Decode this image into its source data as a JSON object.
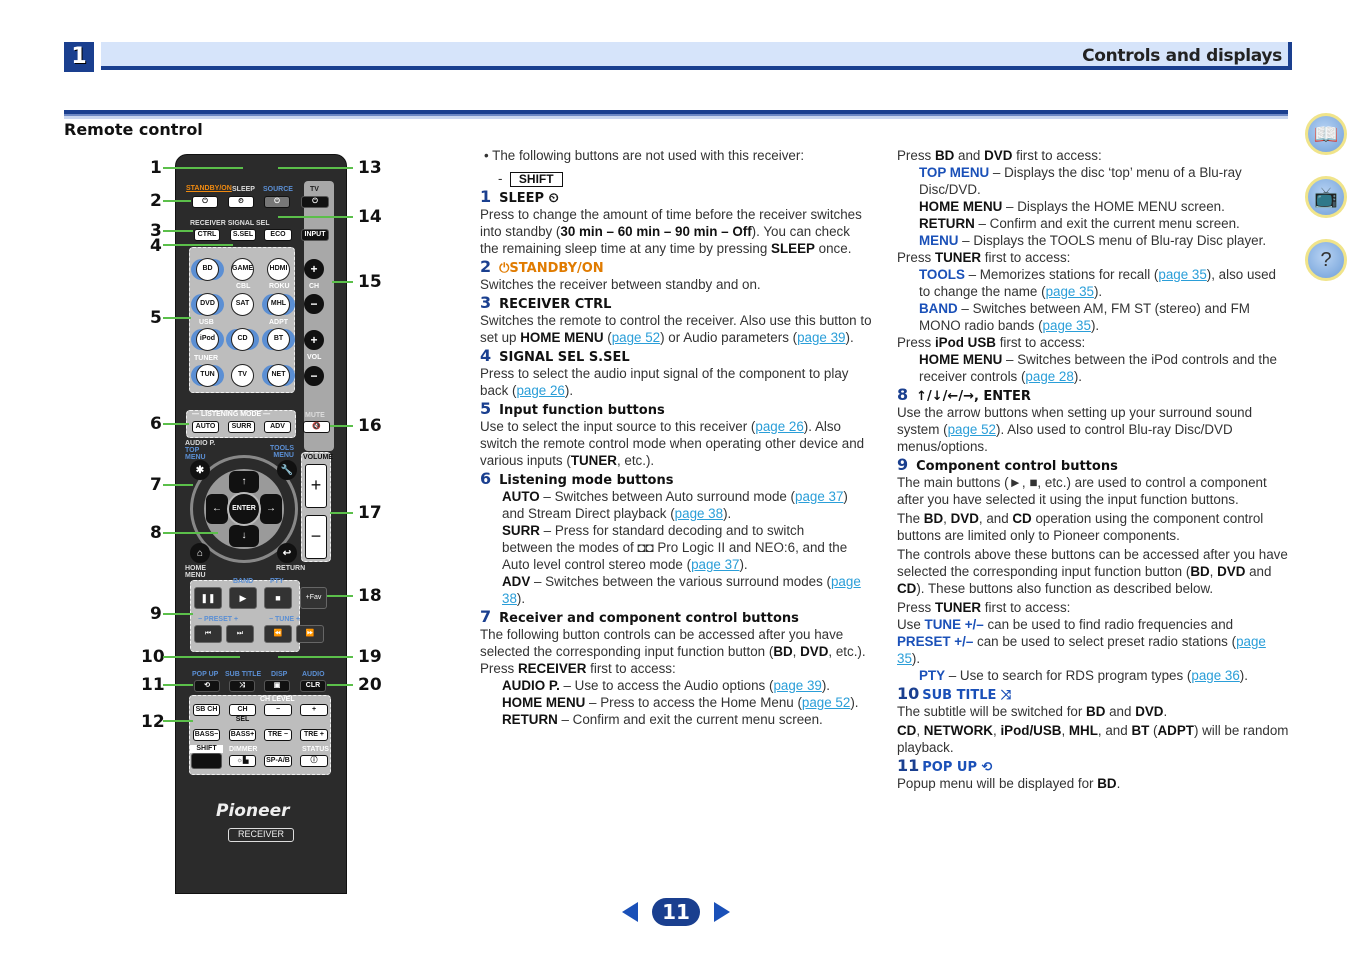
{
  "header": {
    "chapter": "1",
    "title": "Controls and displays"
  },
  "section_title": "Remote control",
  "side_icons": [
    "book-icon",
    "receiver-remote-icon",
    "help-receiver-icon"
  ],
  "remote": {
    "labels": {
      "standby": "STANDBY/ON",
      "sleep": "SLEEP",
      "source": "SOURCE",
      "tv": "TV",
      "receiver_signal_sel": "RECEIVER SIGNAL SEL",
      "ctrl": "CTRL",
      "ssel": "S.SEL",
      "eco": "ECO",
      "input": "INPUT",
      "bd": "BD",
      "game": "GAME",
      "hdmi": "HDMI",
      "cbl": "CBL",
      "roku": "ROKU",
      "dvd": "DVD",
      "sat": "SAT",
      "mhl": "MHL",
      "usb": "USB",
      "adpt": "ADPT",
      "ipod": "iPod",
      "cd": "CD",
      "bt": "BT",
      "tuner": "TUNER",
      "tun": "TUN",
      "tvbtn": "TV",
      "net": "NET",
      "ch": "CH",
      "vol": "VOL",
      "plus": "+",
      "minus": "−",
      "listening_mode": "— LISTENING MODE —",
      "mute": "MUTE",
      "auto": "AUTO",
      "surr": "SURR",
      "adv": "ADV",
      "audio_p": "AUDIO P.",
      "top_menu": "TOP\nMENU",
      "tools": "TOOLS\nMENU",
      "volume": "VOLUME",
      "enter": "ENTER",
      "home_menu": "HOME\nMENU",
      "return": "RETURN",
      "band": "BAND",
      "pty": "PTY",
      "fav": "+Fav",
      "preset": "− PRESET +",
      "tune": "− TUNE +",
      "pop_up": "POP UP",
      "sub_title": "SUB TITLE",
      "disp": "DISP",
      "audio": "AUDIO",
      "clr": "CLR",
      "ch_level": "CH LEVEL",
      "sb_ch": "SB CH",
      "ch_sel": "CH SEL",
      "bass_minus": "BASS−",
      "bass_plus": "BASS+",
      "tre_minus": "TRE −",
      "tre_plus": "TRE +",
      "shift": "SHIFT",
      "dimmer": "DIMMER",
      "sp_ab": "SP-A/B",
      "status": "STATUS",
      "brand": "Pioneer",
      "receiver": "RECEIVER"
    },
    "callouts_left": [
      "1",
      "2",
      "3",
      "4",
      "5",
      "6",
      "7",
      "8",
      "9",
      "10",
      "11",
      "12"
    ],
    "callouts_right": [
      "13",
      "14",
      "15",
      "16",
      "17",
      "18",
      "19",
      "20"
    ]
  },
  "col1": {
    "bullet": "The following buttons are not used with this receiver:",
    "dash": "-",
    "shift": "SHIFT",
    "items": [
      {
        "num": "1",
        "title": "SLEEP ⏲",
        "body": [
          "Press to change the amount of time before the receiver switches into standby (",
          "30 min – 60 min – 90 min – Off",
          "). You can check the remaining sleep time at any time by pressing ",
          "SLEEP",
          " once."
        ]
      },
      {
        "num": "2",
        "title": "⏻STANDBY/ON",
        "body": [
          "Switches the receiver between standby and on."
        ]
      },
      {
        "num": "3",
        "title": "RECEIVER CTRL",
        "body": [
          "Switches the remote to control the receiver. Also use this button to set up ",
          "HOME MENU",
          " (",
          "page 52",
          ") or Audio parameters (",
          "page 39",
          ")."
        ]
      },
      {
        "num": "4",
        "title": "SIGNAL SEL S.SEL",
        "body": [
          "Press to select the audio input signal of the component to play back (",
          "page 26",
          ")."
        ]
      },
      {
        "num": "5",
        "title": "Input function buttons",
        "body": [
          "Use to select the input source to this receiver (",
          "page 26",
          "). Also switch the remote control mode when operating other device and various inputs (",
          "TUNER",
          ", etc.)."
        ]
      },
      {
        "num": "6",
        "title": "Listening mode buttons",
        "sub": [
          {
            "key": "AUTO",
            "text": " – Switches between Auto surround mode (",
            "l1": "page 37",
            "t2": ") and Stream Direct playback (",
            "l2": "page 38",
            "t3": ")."
          },
          {
            "key": "SURR",
            "text": " – Press for standard decoding and to switch"
          },
          {
            "text": "between the modes of ◘◘ Pro Logic II and NEO:6, and the Auto level control stereo mode (",
            "l1": "page 37",
            "t2": ")."
          },
          {
            "key": "ADV",
            "text": " – Switches between the various surround modes (",
            "l1": "page 38",
            "t2": ")."
          }
        ]
      },
      {
        "num": "7",
        "title": "Receiver and component control buttons",
        "body": [
          "The following button controls can be accessed after you have selected the corresponding input function button (",
          "BD",
          ", ",
          "DVD",
          ", etc.)."
        ],
        "press": [
          "Press ",
          "RECEIVER",
          " first to access:"
        ],
        "sub": [
          {
            "key": "AUDIO P.",
            "text": " – Use to access the Audio options (",
            "l1": "page 39",
            "t2": ")."
          },
          {
            "key": "HOME MENU",
            "text": " – Press to access the Home Menu (",
            "l1": "page 52",
            "t2": ")."
          },
          {
            "key": "RETURN",
            "text": " – Confirm and exit the current menu screen."
          }
        ]
      }
    ]
  },
  "col2": {
    "press_bd": [
      "Press ",
      "BD",
      " and ",
      "DVD",
      " first to access:"
    ],
    "bd_items": [
      {
        "key": "TOP MENU",
        "blue": true,
        "text": " – Displays the disc ‘top’ menu of a Blu-ray Disc/DVD."
      },
      {
        "key": "HOME MENU",
        "text": " – Displays the HOME MENU screen."
      },
      {
        "key": "RETURN",
        "text": " – Confirm and exit the current menu screen."
      },
      {
        "key": "MENU",
        "blue": true,
        "text": " – Displays the TOOLS menu of Blu-ray Disc player."
      }
    ],
    "press_tuner": [
      "Press ",
      "TUNER",
      " first to access:"
    ],
    "tuner_items": [
      {
        "key": "TOOLS",
        "text": " – Memorizes stations for recall (",
        "l1": "page 35",
        "t2": "), also used to change the name (",
        "l2": "page 35",
        "t3": ")."
      },
      {
        "key": "BAND",
        "text": " – Switches between AM, FM ST (stereo) and FM MONO radio bands (",
        "l1": "page 35",
        "t2": ")."
      }
    ],
    "press_ipod": [
      "Press ",
      "iPod USB",
      " first to access:"
    ],
    "ipod_items": [
      {
        "key": "HOME MENU",
        "text": " – Switches between the iPod controls and the receiver controls (",
        "l1": "page 28",
        "t2": ")."
      }
    ],
    "item8": {
      "num": "8",
      "title": "↑/↓/←/→, ENTER",
      "body": [
        "Use the arrow buttons when setting up your surround sound system (",
        "page 52",
        "). Also used to control Blu-ray Disc/DVD menus/options."
      ]
    },
    "item9": {
      "num": "9",
      "title": "Component control buttons",
      "p1": "The main buttons (►, ■, etc.) are used to control a component after you have selected it using the input function buttons.",
      "p2": [
        "The ",
        "BD",
        ", ",
        "DVD",
        ", and ",
        "CD",
        " operation using the component control buttons are limited only to Pioneer components."
      ],
      "p3": [
        "The controls above these buttons can be accessed after you have selected the corresponding input function button (",
        "BD",
        ", ",
        "DVD",
        " and ",
        "CD",
        "). These buttons also function as described below."
      ],
      "press": [
        "Press ",
        "TUNER",
        " first to access:"
      ],
      "p4": [
        "Use ",
        "TUNE +/–",
        " can be used to find radio frequencies and ",
        "PRESET +/–",
        " can be used to select preset radio stations (",
        "page 35",
        ")."
      ],
      "pty": {
        "key": "PTY",
        "text": " – Use to search for RDS program types (",
        "l1": "page 36",
        "t2": ")."
      }
    },
    "item10": {
      "num": "10",
      "title": "SUB TITLE ⤨",
      "p1": [
        "The subtitle will be switched for ",
        "BD",
        " and ",
        "DVD",
        "."
      ],
      "p2": [
        "CD",
        ", ",
        "NETWORK",
        ", ",
        "iPod/USB",
        ", ",
        "MHL",
        ", and ",
        "BT",
        " (",
        "ADPT",
        ") will be random playback."
      ]
    },
    "item11": {
      "num": "11",
      "title": "POP UP ⟲",
      "p1": [
        "Popup menu will be displayed for ",
        "BD",
        "."
      ]
    }
  },
  "pager": {
    "page": "11",
    "prev": "previous-page",
    "next": "next-page"
  },
  "colors": {
    "brand_blue": "#1a3f8f",
    "link": "#2a9ed8",
    "standby_orange": "#e07b00",
    "callout_green": "#5bbf4a"
  }
}
